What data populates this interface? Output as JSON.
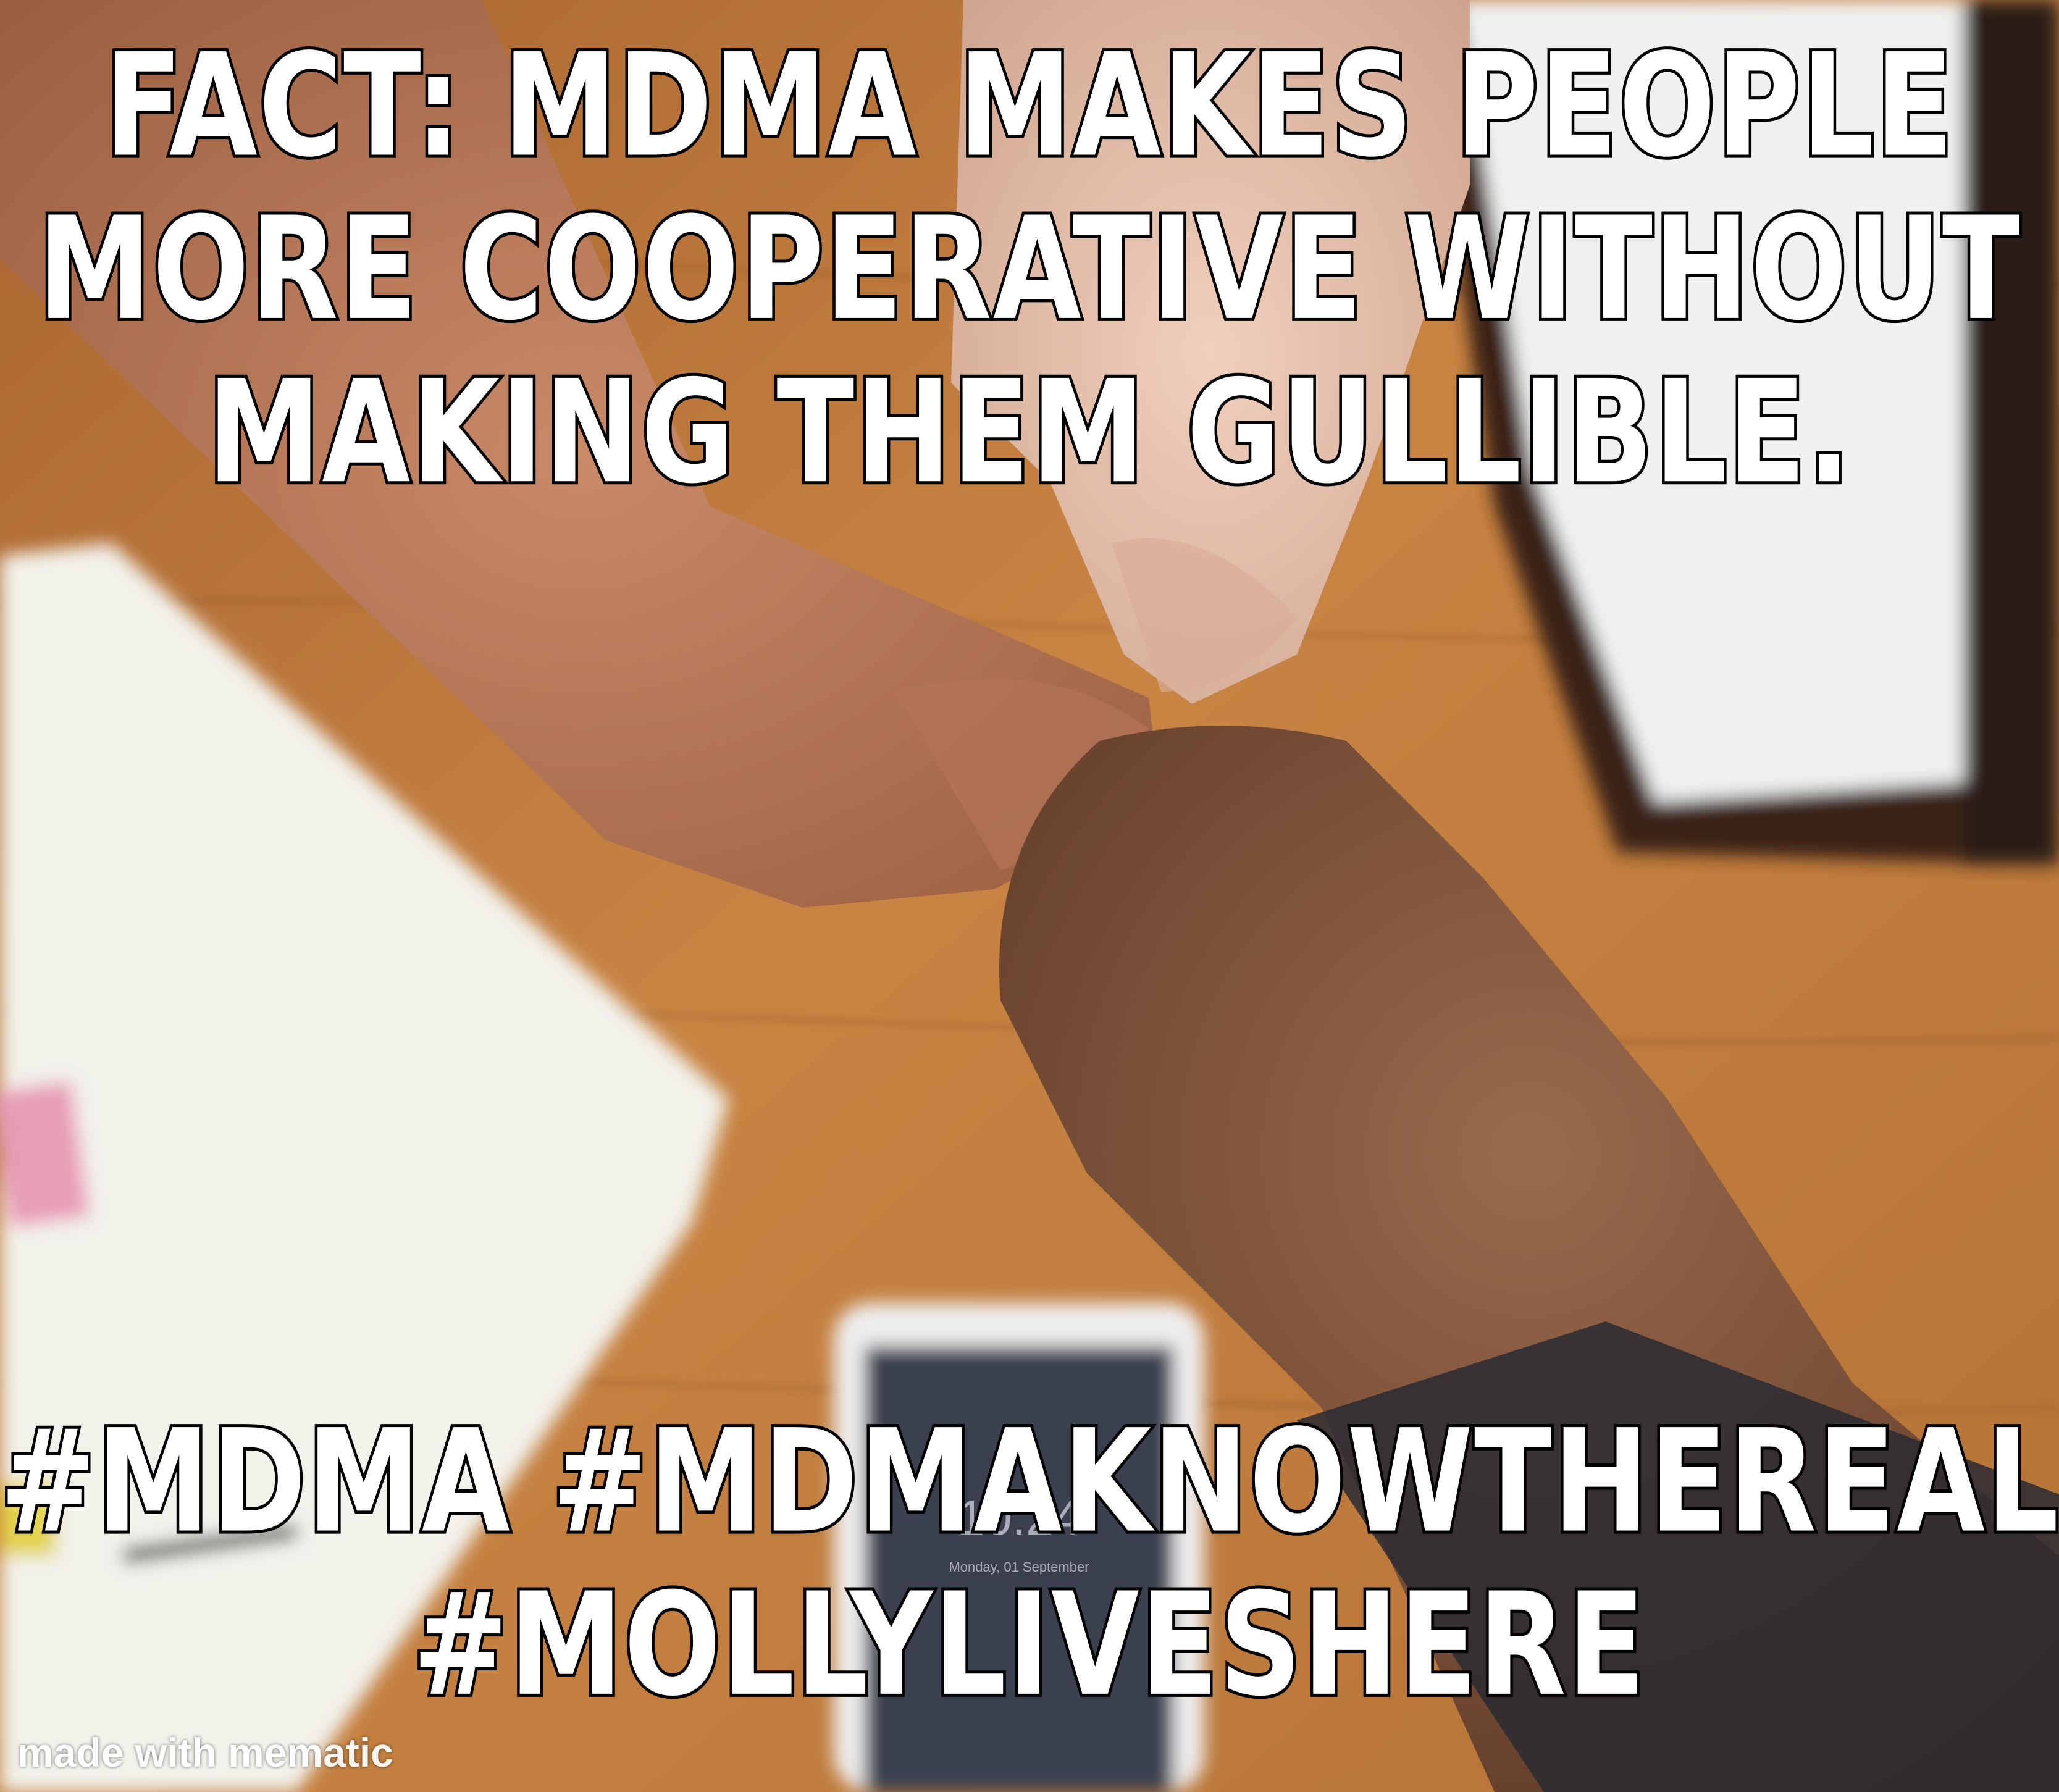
{
  "meme": {
    "top_caption": [
      "FACT: MDMA MAKES PEOPLE",
      "MORE COOPERATIVE WITHOUT",
      "MAKING THEM GULLIBLE."
    ],
    "bottom_caption": [
      "#MDMA #MDMAKNOWTHEREALFACTS",
      "#MOLLYLIVESHERE"
    ],
    "watermark": "made with mematic"
  },
  "photo": {
    "subject": "three fists bumping over a wooden table",
    "phone_time": "10:24",
    "phone_date": "Monday, 01 September"
  },
  "colors": {
    "table": "#b8773e",
    "caption_fill": "#ffffff",
    "caption_stroke": "#000000"
  }
}
